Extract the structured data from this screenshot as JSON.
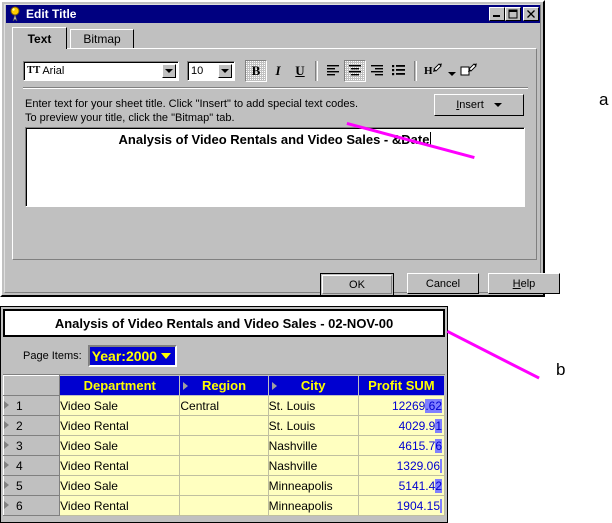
{
  "dialog": {
    "title": "Edit Title",
    "title_icon": "pushpin-icon",
    "window_buttons": {
      "minimize": "_",
      "maximize": "❐",
      "close": "✕"
    },
    "tabs": [
      {
        "label": "Text",
        "active": true
      },
      {
        "label": "Bitmap",
        "active": false
      }
    ],
    "toolbar": {
      "font_name": "Arial",
      "font_name_glyph": "TT",
      "font_size": "10",
      "bold_label": "B",
      "italic_label": "I",
      "underline_label": "U",
      "align_left": "align-left-icon",
      "align_center": "align-center-icon",
      "align_right": "align-right-icon",
      "bullet_list": "bullet-list-icon",
      "text_color": "text-color-icon",
      "fill_color": "fill-color-icon"
    },
    "instructions_line1": "Enter text for your sheet title. Click \"Insert\" to add special text codes.",
    "instructions_line2": "To preview your title, click the \"Bitmap\" tab.",
    "insert_button": "Insert",
    "insert_button_mnemonic": "I",
    "insert_button_rest": "nsert",
    "title_text_value": "Analysis of Video Rentals and Video Sales  - &Date",
    "buttons": {
      "ok": "OK",
      "cancel": "Cancel",
      "help_mnemonic": "H",
      "help_rest": "elp"
    }
  },
  "report": {
    "title": "Analysis of Video Rentals and Video Sales  - 02-NOV-00",
    "page_items_label": "Page Items:",
    "page_item_value": "Year:2000",
    "columns": [
      "Department",
      "Region",
      "City",
      "Profit SUM"
    ],
    "column_has_sort_marker": [
      false,
      true,
      true,
      false
    ],
    "rows": [
      {
        "n": "1",
        "department": "Video Sale",
        "region": "Central",
        "city": "St. Louis",
        "profit_plain": "12269",
        "profit_sel": ".62",
        "profit_full": "12269.62"
      },
      {
        "n": "2",
        "department": "Video Rental",
        "region": "",
        "city": "St. Louis",
        "profit_plain": "4029.9",
        "profit_sel": "1",
        "profit_full": "4029.91"
      },
      {
        "n": "3",
        "department": "Video Sale",
        "region": "",
        "city": "Nashville",
        "profit_plain": "4615.7",
        "profit_sel": "6",
        "profit_full": "4615.76"
      },
      {
        "n": "4",
        "department": "Video Rental",
        "region": "",
        "city": "Nashville",
        "profit_plain": "1329.06",
        "profit_sel": "",
        "profit_full": "1329.06"
      },
      {
        "n": "5",
        "department": "Video Sale",
        "region": "",
        "city": "Minneapolis",
        "profit_plain": "5141.4",
        "profit_sel": "2",
        "profit_full": "5141.42"
      },
      {
        "n": "6",
        "department": "Video Rental",
        "region": "",
        "city": "Minneapolis",
        "profit_plain": "1904.15",
        "profit_sel": "",
        "profit_full": "1904.15"
      }
    ]
  },
  "annotations": [
    {
      "label": "a"
    },
    {
      "label": "b"
    }
  ],
  "colors": {
    "titlebar": "#000080",
    "dialog_face": "#c0c0c0",
    "grid_header_bg": "#0000d0",
    "grid_header_fg": "#ffff00",
    "cell_bg": "#ffffc0",
    "number_fg": "#0000d0",
    "selection": "#8080ff",
    "annotation": "#ff00ff"
  }
}
